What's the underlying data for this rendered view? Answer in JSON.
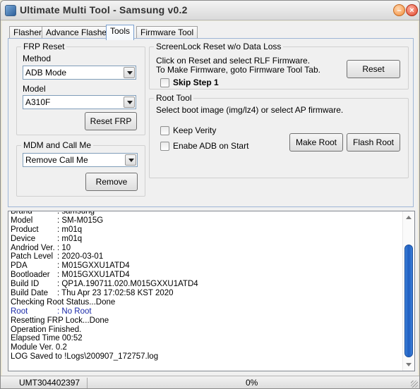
{
  "window": {
    "title": "Ultimate Multi Tool - Samsung v0.2"
  },
  "tabs": [
    {
      "label": "Flasher",
      "active": false
    },
    {
      "label": "Advance Flasher",
      "active": false
    },
    {
      "label": "Tools",
      "active": true
    },
    {
      "label": "Firmware Tool",
      "active": false
    }
  ],
  "frp": {
    "legend": "FRP Reset",
    "method_label": "Method",
    "method_value": "ADB Mode",
    "model_label": "Model",
    "model_value": "A310F",
    "reset_button": "Reset FRP"
  },
  "mdm": {
    "legend": "MDM and Call Me",
    "option_value": "Remove Call Me",
    "remove_button": "Remove"
  },
  "screenlock": {
    "legend": "ScreenLock Reset w/o Data Loss",
    "line1": "Click on Reset and select RLF Firmware.",
    "line2": "To Make Firmware, goto Firmware Tool Tab.",
    "skip_label": "Skip Step 1",
    "skip_checked": false,
    "reset_button": "Reset"
  },
  "root": {
    "legend": "Root Tool",
    "description": "Select boot image (img/lz4) or select AP firmware.",
    "keep_verity_label": "Keep Verity",
    "keep_verity_checked": false,
    "enable_adb_label": "Enabe ADB on Start",
    "enable_adb_checked": false,
    "make_root_button": "Make Root",
    "flash_root_button": "Flash Root"
  },
  "log": [
    {
      "key": "Brand",
      "value": ": samsung"
    },
    {
      "key": "Model",
      "value": ": SM-M015G"
    },
    {
      "key": "Product",
      "value": ": m01q"
    },
    {
      "key": "Device",
      "value": ": m01q"
    },
    {
      "key": "Andriod Ver.",
      "value": ": 10"
    },
    {
      "key": "Patch Level",
      "value": ": 2020-03-01"
    },
    {
      "key": "PDA",
      "value": ": M015GXXU1ATD4"
    },
    {
      "key": "Bootloader",
      "value": ": M015GXXU1ATD4"
    },
    {
      "key": "Build ID",
      "value": ": QP1A.190711.020.M015GXXU1ATD4"
    },
    {
      "key": "Build Date",
      "value": ": Thu Apr 23 17:02:58 KST 2020"
    },
    {
      "key": "Checking Root Status...Done",
      "value": ""
    },
    {
      "key": "Root",
      "value": ": No Root",
      "color": "#1a2aa8"
    },
    {
      "key": "Resetting FRP Lock...Done",
      "value": ""
    },
    {
      "key": "Operation Finished.",
      "value": ""
    },
    {
      "key": "Elapsed Time 00:52",
      "value": ""
    },
    {
      "key": "Module Ver. 0.2",
      "value": ""
    },
    {
      "key": "LOG Saved to !Logs\\200907_172757.log",
      "value": ""
    }
  ],
  "status": {
    "id": "UMT304402397",
    "progress_text": "0%",
    "progress": 0
  },
  "colors": {
    "accent": "#1f5fc2",
    "root_status": "#1a2aa8",
    "tab_border": "#7aa0d0"
  }
}
